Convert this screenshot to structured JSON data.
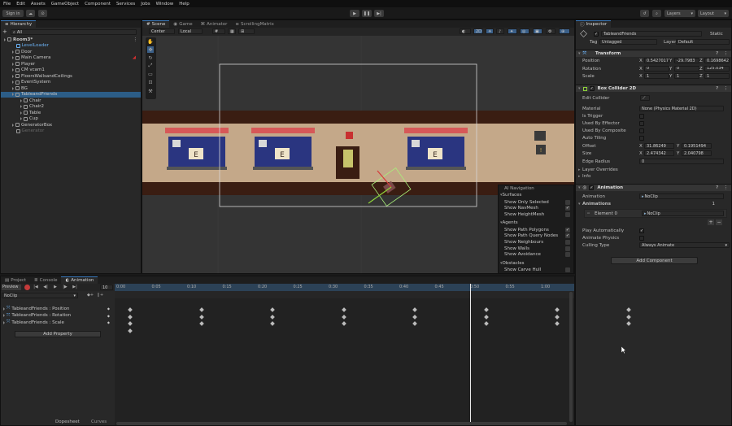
{
  "menu": [
    "File",
    "Edit",
    "Assets",
    "GameObject",
    "Component",
    "Services",
    "Jobs",
    "Window",
    "Help"
  ],
  "toolbar": {
    "signin": "Sign in",
    "layers": "Layers",
    "layout": "Layout"
  },
  "hierarchy": {
    "tab": "Hierarchy",
    "search": "All",
    "items": [
      {
        "label": "Room3*",
        "indent": 0,
        "kind": "scene"
      },
      {
        "label": "LevelLoader",
        "indent": 1,
        "kind": "blue"
      },
      {
        "label": "Door",
        "indent": 1,
        "kind": "obj"
      },
      {
        "label": "Main Camera",
        "indent": 1,
        "kind": "obj"
      },
      {
        "label": "Player",
        "indent": 1,
        "kind": "obj"
      },
      {
        "label": "CM vcam1",
        "indent": 1,
        "kind": "obj"
      },
      {
        "label": "FloorsWallsandCeilings",
        "indent": 1,
        "kind": "obj"
      },
      {
        "label": "EventSystem",
        "indent": 1,
        "kind": "obj"
      },
      {
        "label": "BG",
        "indent": 1,
        "kind": "obj"
      },
      {
        "label": "TableandFriends",
        "indent": 1,
        "kind": "obj",
        "selected": true
      },
      {
        "label": "Chair",
        "indent": 2,
        "kind": "obj"
      },
      {
        "label": "Chair2",
        "indent": 2,
        "kind": "obj"
      },
      {
        "label": "Table",
        "indent": 2,
        "kind": "obj"
      },
      {
        "label": "Cup",
        "indent": 2,
        "kind": "obj"
      },
      {
        "label": "GeneratorBox",
        "indent": 1,
        "kind": "obj"
      },
      {
        "label": "Generator",
        "indent": 1,
        "kind": "dim"
      }
    ]
  },
  "scene_tabs": [
    "Scene",
    "Game",
    "Animator",
    "ScrollingMatrix"
  ],
  "scene_toolbar": {
    "pivot": "Center",
    "space": "Local",
    "mode2d": "2D"
  },
  "ai_nav": {
    "title": "AI Navigation",
    "sections": [
      {
        "name": "Surfaces",
        "rows": [
          {
            "label": "Show Only Selected",
            "checked": false
          },
          {
            "label": "Show NavMesh",
            "checked": true
          },
          {
            "label": "Show HeightMesh",
            "checked": false
          }
        ]
      },
      {
        "name": "Agents",
        "rows": [
          {
            "label": "Show Path Polygons",
            "checked": true
          },
          {
            "label": "Show Path Query Nodes",
            "checked": true
          },
          {
            "label": "Show Neighbours",
            "checked": false
          },
          {
            "label": "Show Walls",
            "checked": false
          },
          {
            "label": "Show Avoidance",
            "checked": false
          }
        ]
      },
      {
        "name": "Obstacles",
        "rows": [
          {
            "label": "Show Carve Hull",
            "checked": false
          }
        ]
      }
    ]
  },
  "inspector": {
    "tab": "Inspector",
    "object_name": "TableandFriends",
    "static_label": "Static",
    "tag_label": "Tag",
    "tag": "Untagged",
    "layer_label": "Layer",
    "layer": "Default",
    "transform": {
      "title": "Transform",
      "rows": [
        {
          "label": "Position",
          "x": "0.5427017",
          "y": "-29.7983",
          "z": "0.1698642"
        },
        {
          "label": "Rotation",
          "x": "0",
          "y": "0",
          "z": "125.034"
        },
        {
          "label": "Scale",
          "x": "1",
          "y": "1",
          "z": "1"
        }
      ]
    },
    "box_collider": {
      "title": "Box Collider 2D",
      "edit_collider": "Edit Collider",
      "material_label": "Material",
      "material": "None (Physics Material 2D)",
      "is_trigger": "Is Trigger",
      "used_by_effector": "Used By Effector",
      "used_by_composite": "Used By Composite",
      "auto_tiling": "Auto Tiling",
      "offset_label": "Offset",
      "offset_x": "31.86249",
      "offset_y": "0.1951494",
      "size_label": "Size",
      "size_x": "2.474342",
      "size_y": "2.040798",
      "edge_radius_label": "Edge Radius",
      "edge_radius": "0",
      "layer_overrides": "Layer Overrides",
      "info": "Info"
    },
    "animation": {
      "title": "Animation",
      "animation_label": "Animation",
      "animation_value": "NoClip",
      "animations_label": "Animations",
      "animations_count": "1",
      "element_label": "Element 0",
      "element_value": "NoClip",
      "play_auto": "Play Automatically",
      "animate_physics": "Animate Physics",
      "culling_label": "Culling Type",
      "culling_value": "Always Animate"
    },
    "add_component": "Add Component"
  },
  "bottom": {
    "tabs": [
      "Project",
      "Console",
      "Animation"
    ],
    "preview": "Preview",
    "frame": "10",
    "clip": "NoClip",
    "properties": [
      "TableandFriends : Position",
      "TableandFriends : Rotation",
      "TableandFriends : Scale"
    ],
    "add_property": "Add Property",
    "ticks": [
      "0:00",
      "0:05",
      "0:10",
      "0:15",
      "0:20",
      "0:25",
      "0:30",
      "0:35",
      "0:40",
      "0:45",
      "0:50",
      "0:55",
      "1:00"
    ],
    "dopesheet": "Dopesheet",
    "curves": "Curves"
  }
}
